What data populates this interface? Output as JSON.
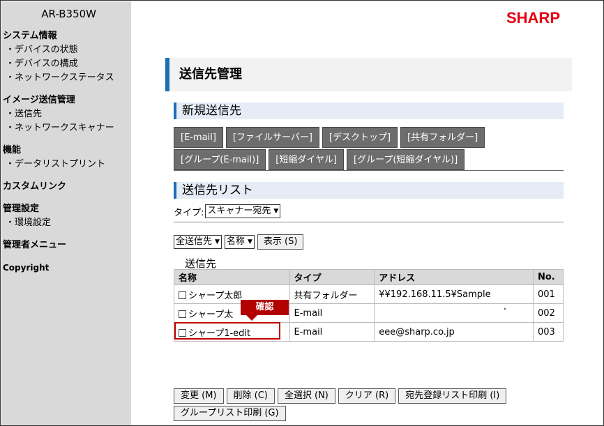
{
  "sidebar": {
    "model": "AR-B350W",
    "sections": [
      {
        "title": "システム情報",
        "items": [
          "デバイスの状態",
          "デバイスの構成",
          "ネットワークステータス"
        ]
      },
      {
        "title": "イメージ送信管理",
        "items": [
          "送信先",
          "ネットワークスキャナー"
        ]
      },
      {
        "title": "機能",
        "items": [
          "データリストプリント"
        ]
      },
      {
        "title": "カスタムリンク",
        "items": []
      },
      {
        "title": "管理設定",
        "items": [
          "環境設定"
        ]
      },
      {
        "title": "管理者メニュー",
        "items": []
      },
      {
        "title": "Copyright",
        "items": []
      }
    ]
  },
  "header": {
    "logo": "SHARP",
    "page_title": "送信先管理"
  },
  "new_dest": {
    "title": "新規送信先",
    "tabs_row1": [
      "[E-mail]",
      "[ファイルサーバー]",
      "[デスクトップ]",
      "[共有フォルダー]"
    ],
    "tabs_row2": [
      "[グループ(E-mail)]",
      "[短縮ダイヤル]",
      "[グループ(短縮ダイヤル)]"
    ]
  },
  "dest_list": {
    "title": "送信先リスト",
    "type_label": "タイプ:",
    "type_value": "スキャナー宛先",
    "filter1": "全送信先",
    "filter2": "名称",
    "show_button": "表示 (S)",
    "caption": "送信先",
    "columns": [
      "名称",
      "タイプ",
      "アドレス",
      "No."
    ],
    "rows": [
      {
        "name": "シャープ太郎",
        "type": "共有フォルダー",
        "address": "¥¥192.168.11.5¥Sample",
        "no": "001"
      },
      {
        "name": "シャープ太",
        "type": "E-mail",
        "address": "",
        "no": "002"
      },
      {
        "name": "シャープ1-edit",
        "type": "E-mail",
        "address": "eee@sharp.co.jp",
        "no": "003"
      }
    ],
    "callout": "確認"
  },
  "actions": [
    "変更 (M)",
    "削除 (C)",
    "全選択 (N)",
    "クリア (R)",
    "宛先登録リスト印刷 (I)",
    "グループリスト印刷 (G)"
  ],
  "colors": {
    "accent": "#1a6fb5",
    "brand": "#e60012",
    "tab": "#6d6d6d",
    "callout": "#b30000"
  }
}
